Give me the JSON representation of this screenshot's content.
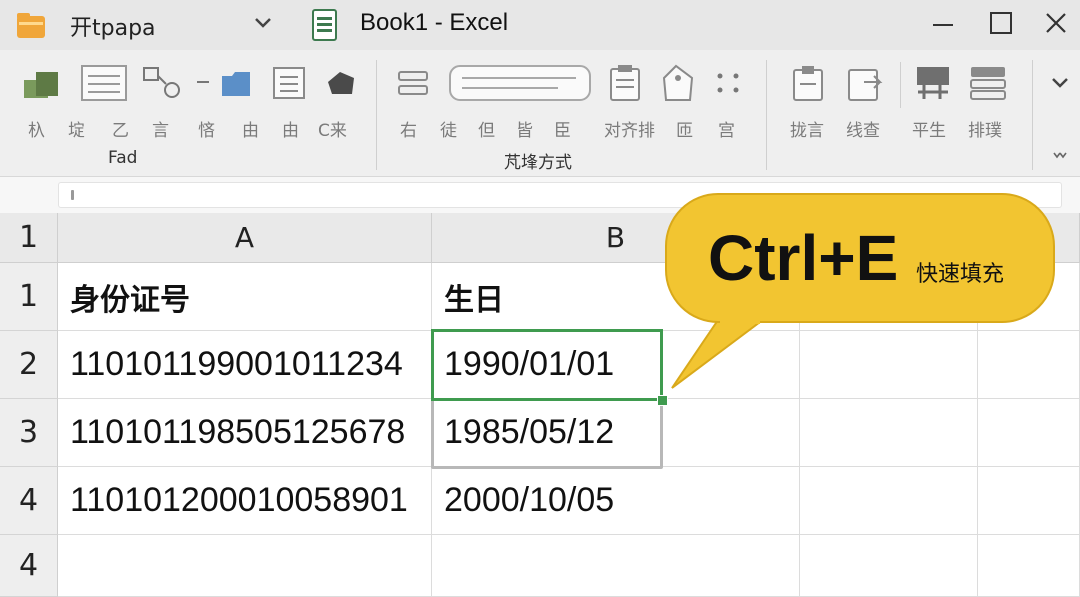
{
  "titlebar": {
    "app_menu": "开tpapa",
    "window_title": "Book1 - Excel"
  },
  "ribbon": {
    "group1": {
      "buttons": [
        "杁",
        "埞",
        "乙",
        "言",
        "悋",
        "由",
        "由",
        "C来"
      ],
      "label": "Fad"
    },
    "group2": {
      "buttons": [
        "右",
        "徒",
        "但",
        "皆",
        "臣",
        "对齐排",
        "匝",
        "宫"
      ],
      "label": "芃埄方式"
    },
    "group3": {
      "buttons": [
        "拢言",
        "线查",
        "平生",
        "排璞"
      ]
    }
  },
  "formula_bar": {
    "content": ""
  },
  "grid": {
    "corner": "1",
    "columns": [
      "A",
      "B"
    ],
    "row_numbers": [
      "1",
      "2",
      "3",
      "4",
      "4"
    ],
    "rows": [
      [
        "身份证号",
        "生日"
      ],
      [
        "110101199001011234",
        "1990/01/01"
      ],
      [
        "110101198505125678",
        "1985/05/12"
      ],
      [
        "110101200010058901",
        "2000/10/05"
      ],
      [
        "",
        ""
      ]
    ]
  },
  "callout": {
    "shortcut": "Ctrl+E",
    "caption": "快速填充"
  },
  "colors": {
    "accent_green": "#3f9b4f",
    "callout_yellow": "#f2c531",
    "excel_icon": "#3d7a4f"
  }
}
